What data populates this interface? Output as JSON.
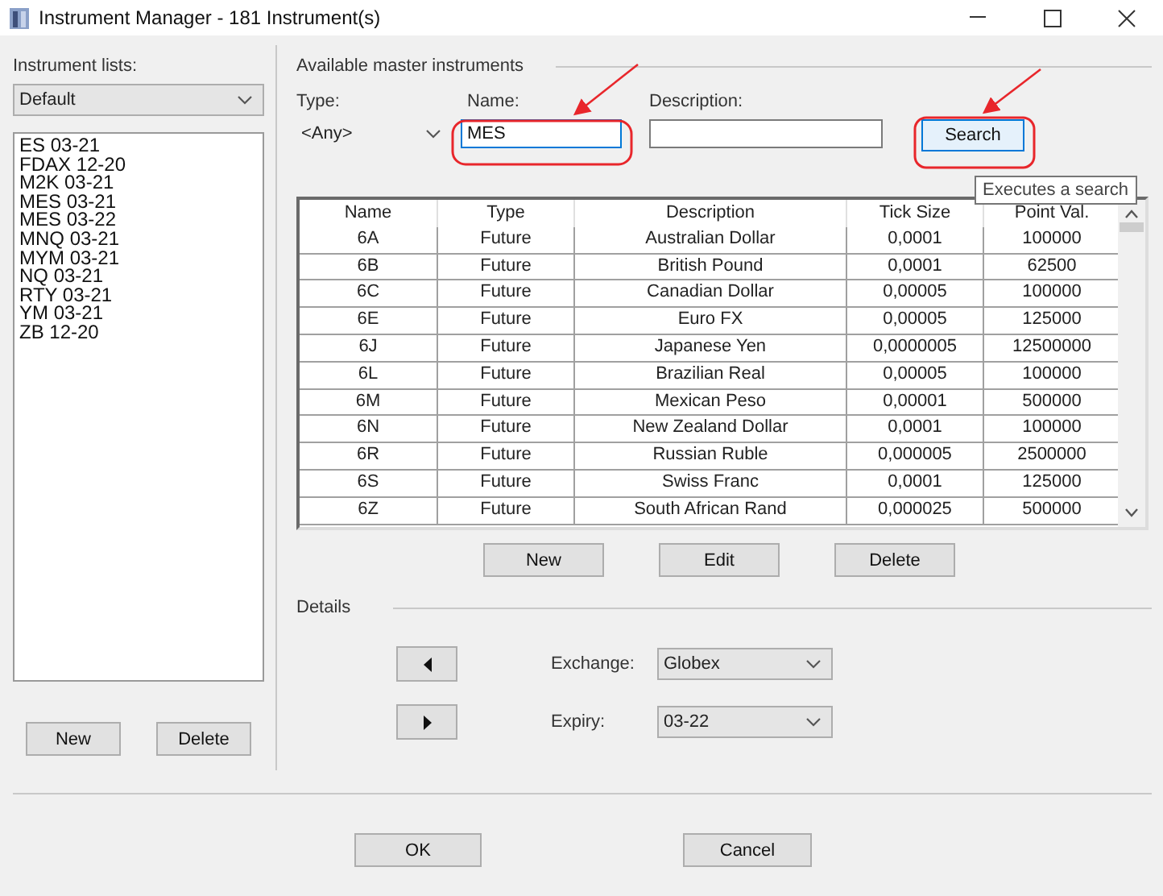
{
  "window": {
    "title": "Instrument Manager - 181 Instrument(s)"
  },
  "instrument_lists": {
    "label": "Instrument lists:",
    "dropdown": {
      "value": "Default"
    },
    "items": [
      {
        "label": "ES 03-21"
      },
      {
        "label": "FDAX 12-20"
      },
      {
        "label": "M2K 03-21"
      },
      {
        "label": "MES 03-21"
      },
      {
        "label": "MES 03-22"
      },
      {
        "label": "MNQ 03-21"
      },
      {
        "label": "MYM 03-21"
      },
      {
        "label": "NQ 03-21"
      },
      {
        "label": "RTY 03-21"
      },
      {
        "label": "YM 03-21"
      },
      {
        "label": "ZB 12-20"
      }
    ],
    "buttons": [
      "New",
      "Delete"
    ]
  },
  "master": {
    "title": "Available master instruments",
    "type": {
      "label": "Type:",
      "value": "<Any>"
    },
    "name": {
      "label": "Name:",
      "value": "MES",
      "focused": true
    },
    "description": {
      "label": "Description:"
    },
    "search_button": {
      "label": "Search",
      "hovered": true
    },
    "tooltip": "Executes a search",
    "table": {
      "columns": [
        "Name",
        "Type",
        "Description",
        "Tick Size",
        "Point Val."
      ],
      "rows": [
        [
          "6A",
          "Future",
          "Australian Dollar",
          "0,0001",
          "100000"
        ],
        [
          "6B",
          "Future",
          "British Pound",
          "0,0001",
          "62500"
        ],
        [
          "6C",
          "Future",
          "Canadian Dollar",
          "0,00005",
          "100000"
        ],
        [
          "6E",
          "Future",
          "Euro FX",
          "0,00005",
          "125000"
        ],
        [
          "6J",
          "Future",
          "Japanese Yen",
          "0,0000005",
          "12500000"
        ],
        [
          "6L",
          "Future",
          "Brazilian Real",
          "0,00005",
          "100000"
        ],
        [
          "6M",
          "Future",
          "Mexican Peso",
          "0,00001",
          "500000"
        ],
        [
          "6N",
          "Future",
          "New Zealand Dollar",
          "0,0001",
          "100000"
        ],
        [
          "6R",
          "Future",
          "Russian Ruble",
          "0,000005",
          "2500000"
        ],
        [
          "6S",
          "Future",
          "Swiss Franc",
          "0,0001",
          "125000"
        ],
        [
          "6Z",
          "Future",
          "South African Rand",
          "0,000025",
          "500000"
        ]
      ]
    },
    "buttons": [
      "New",
      "Edit",
      "Delete"
    ]
  },
  "details": {
    "title": "Details",
    "exchange": {
      "label": "Exchange:",
      "value": "Globex"
    },
    "expiry": {
      "label": "Expiry:",
      "value": "03-22"
    }
  },
  "footer_buttons": [
    "OK",
    "Cancel"
  ]
}
